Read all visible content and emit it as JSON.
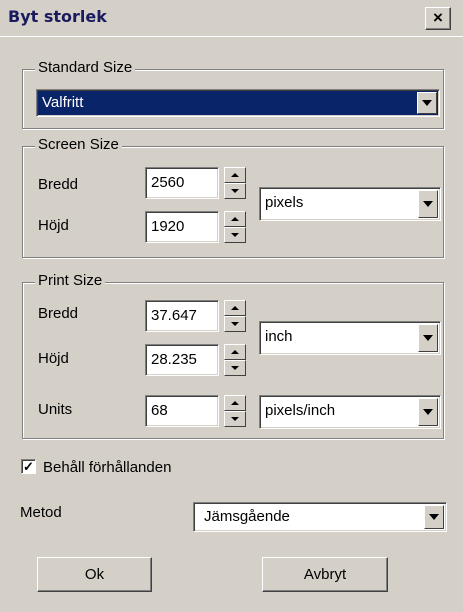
{
  "window": {
    "title": "Byt storlek",
    "close_glyph": "×"
  },
  "standard_size": {
    "group_label": "Standard Size",
    "selected": "Valfritt"
  },
  "screen_size": {
    "group_label": "Screen Size",
    "width_label": "Bredd",
    "width_value": "2560",
    "height_label": "Höjd",
    "height_value": "1920",
    "unit": "pixels"
  },
  "print_size": {
    "group_label": "Print Size",
    "width_label": "Bredd",
    "width_value": "37.647",
    "height_label": "Höjd",
    "height_value": "28.235",
    "unit": "inch",
    "units_label": "Units",
    "units_value": "68",
    "resolution_unit": "pixels/inch"
  },
  "keep_ratio": {
    "label": "Behåll förhållanden",
    "checked": true,
    "check_glyph": "✓"
  },
  "method": {
    "label": "Metod",
    "selected": "Jämsgående"
  },
  "buttons": {
    "ok": "Ok",
    "cancel": "Avbryt"
  },
  "colors": {
    "face": "#d4d0c8",
    "selection": "#0a246a",
    "title_text": "#1a1a5e"
  }
}
